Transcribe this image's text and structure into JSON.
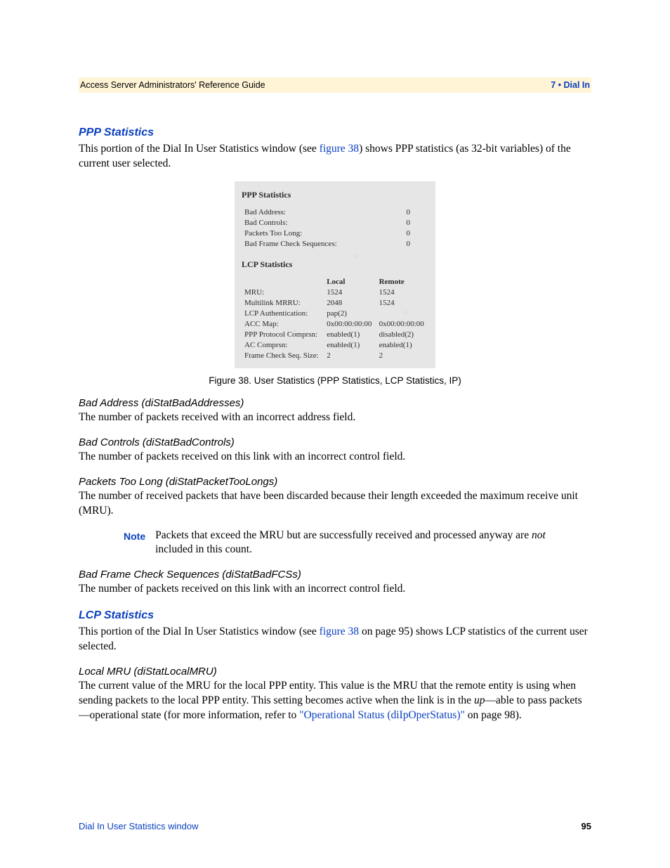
{
  "header": {
    "left": "Access Server Administrators' Reference Guide",
    "right_chapter": "7 • Dial In"
  },
  "ppp_stats": {
    "heading": "PPP Statistics",
    "intro_before_link": "This portion of the Dial In User Statistics window (see ",
    "intro_link": "figure 38",
    "intro_after_link": ") shows PPP statistics (as 32-bit variables) of the current user selected."
  },
  "figure": {
    "ppp_title": "PPP Statistics",
    "ppp_rows": [
      {
        "label": "Bad Address:",
        "value": "0"
      },
      {
        "label": "Bad Controls:",
        "value": "0"
      },
      {
        "label": "Packets Too Long:",
        "value": "0"
      },
      {
        "label": "Bad Frame Check Sequences:",
        "value": "0"
      }
    ],
    "lcp_title": "LCP Statistics",
    "lcp_cols": {
      "left": "",
      "mid": "Local",
      "right": "Remote"
    },
    "lcp_rows": [
      {
        "label": "MRU:",
        "local": "1524",
        "remote": "1524"
      },
      {
        "label": "Multilink MRRU:",
        "local": "2048",
        "remote": "1524"
      },
      {
        "label": "LCP Authentication:",
        "local": "pap(2)",
        "remote": ""
      },
      {
        "label": "ACC Map:",
        "local": "0x00:00:00:00",
        "remote": "0x00:00:00:00"
      },
      {
        "label": "PPP Protocol Comprsn:",
        "local": "enabled(1)",
        "remote": "disabled(2)"
      },
      {
        "label": "AC Comprsn:",
        "local": "enabled(1)",
        "remote": "enabled(1)"
      },
      {
        "label": "Frame Check Seq. Size:",
        "local": "2",
        "remote": "2"
      }
    ],
    "caption": "Figure 38. User Statistics (PPP Statistics, LCP Statistics, IP)"
  },
  "subsections": {
    "bad_address": {
      "heading": "Bad Address (diStatBadAddresses)",
      "text": "The number of packets received with an incorrect address field."
    },
    "bad_controls": {
      "heading": "Bad Controls (diStatBadControls)",
      "text": "The number of packets received on this link with an incorrect control field."
    },
    "packets_too_long": {
      "heading": "Packets Too Long (diStatPacketTooLongs)",
      "text": "The number of received packets that have been discarded because their length exceeded the maximum receive unit (MRU)."
    },
    "note": {
      "label": "Note",
      "text_before_ital": "Packets that exceed the MRU but are successfully received and processed anyway are ",
      "ital": "not",
      "text_after_ital": " included in this count."
    },
    "bad_fcs": {
      "heading": "Bad Frame Check Sequences (diStatBadFCSs)",
      "text": "The number of packets received on this link with an incorrect control field."
    }
  },
  "lcp_stats": {
    "heading": "LCP Statistics",
    "intro_before_link": "This portion of the Dial In User Statistics window (see ",
    "intro_link": "figure 38",
    "intro_after_link": " on page 95) shows LCP statistics of the current user selected."
  },
  "local_mru": {
    "heading": "Local MRU (diStatLocalMRU)",
    "text_before_up": "The current value of the MRU for the local PPP entity. This value is the MRU that the remote entity is using when sending packets to the local PPP entity. This setting becomes active when the link is in the ",
    "up": "up",
    "text_between": "—able to pass packets—operational state (for more information, refer to ",
    "link": "\"Operational Status (diIpOperStatus)\"",
    "text_after_link": " on page 98)."
  },
  "footer": {
    "left": "Dial In User Statistics window",
    "page": "95"
  }
}
